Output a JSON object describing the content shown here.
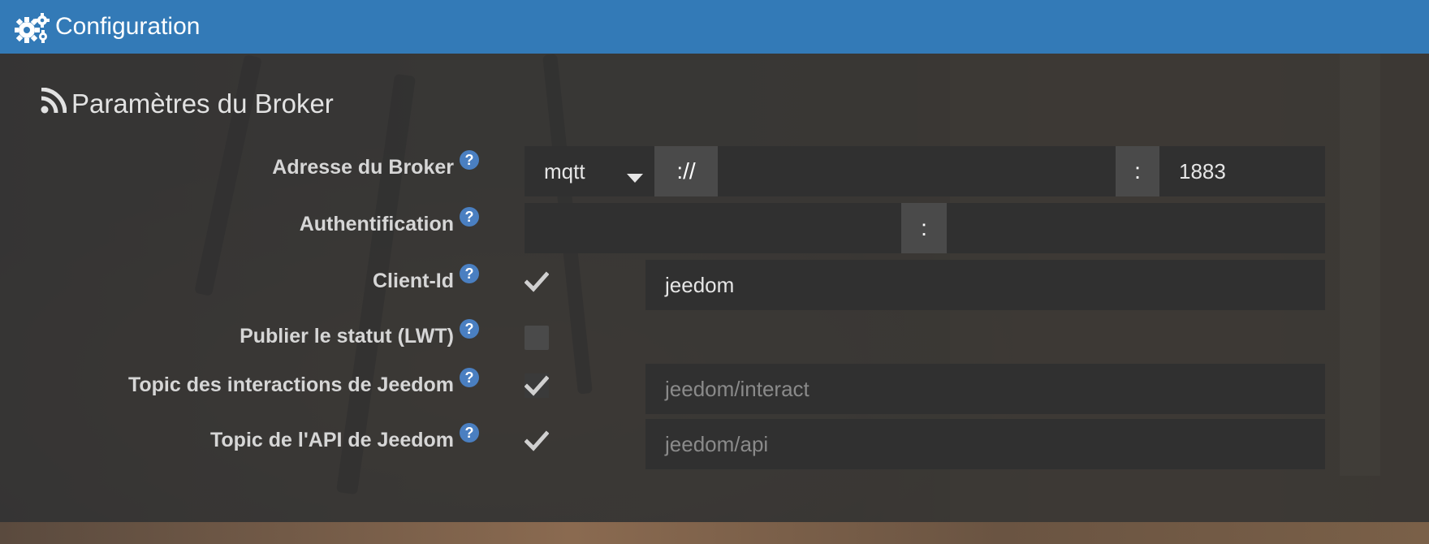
{
  "header": {
    "title": "Configuration",
    "icon": "gears-icon",
    "background": "#337ab7"
  },
  "section": {
    "title": "Paramètres du Broker",
    "icon": "rss-icon"
  },
  "form": {
    "broker_address": {
      "label": "Adresse du Broker",
      "help": "?",
      "protocol": "mqtt",
      "separator": "://",
      "host": "",
      "port_separator": ":",
      "port": "1883"
    },
    "authentication": {
      "label": "Authentification",
      "help": "?",
      "username": "",
      "separator": ":",
      "password": ""
    },
    "client_id": {
      "label": "Client-Id",
      "help": "?",
      "checked": true,
      "value": "jeedom"
    },
    "lwt": {
      "label": "Publier le statut (LWT)",
      "help": "?",
      "checked": false
    },
    "interact_topic": {
      "label": "Topic des interactions de Jeedom",
      "help": "?",
      "checked": true,
      "placeholder": "jeedom/interact"
    },
    "api_topic": {
      "label": "Topic de l'API de Jeedom",
      "help": "?",
      "checked": true,
      "placeholder": "jeedom/api"
    }
  },
  "colors": {
    "accent": "#337ab7",
    "help_icon": "#4a7fc1",
    "field_bg": "#303030",
    "addon_bg": "#4a4a4a"
  }
}
